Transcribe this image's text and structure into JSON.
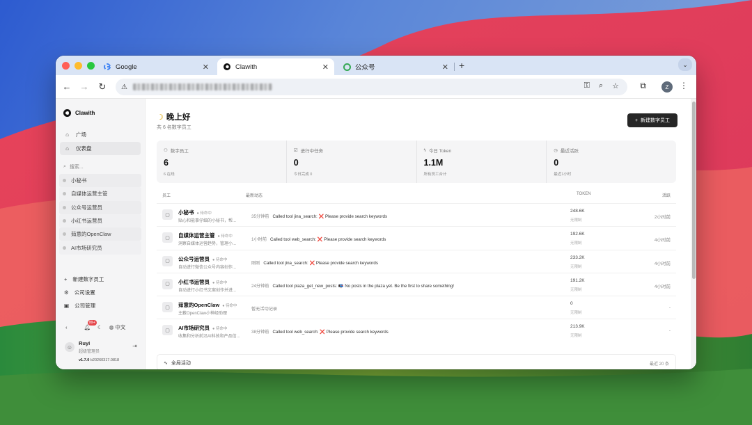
{
  "browser": {
    "tabs": [
      {
        "label": "Google",
        "active": false
      },
      {
        "label": "Clawith",
        "active": true
      },
      {
        "label": "公众号",
        "active": false
      }
    ],
    "new_tab": "+",
    "profile_initial": "Z"
  },
  "app": {
    "brand": "Clawith",
    "nav": [
      {
        "label": "广场",
        "icon": "plaza-icon"
      },
      {
        "label": "仪表盘",
        "icon": "dashboard-icon",
        "active": true
      }
    ],
    "search_placeholder": "搜索...",
    "agents": [
      "小秘书",
      "自媒体运营主管",
      "公众号运营员",
      "小红书运营员",
      "茹意的OpenClaw",
      "AI市场研究员"
    ],
    "actions": [
      {
        "label": "新建数字员工",
        "icon": "plus-icon"
      },
      {
        "label": "公司设置",
        "icon": "gear-icon"
      },
      {
        "label": "公司管理",
        "icon": "building-icon"
      }
    ],
    "notification_count": "99+",
    "language": "中文",
    "user": {
      "name": "Ruyi",
      "role": "超级管理员"
    },
    "version": "v1.7.0",
    "build": "b20260317.0818"
  },
  "dashboard": {
    "greeting": "晚上好",
    "subtitle": "共 6 名数字员工",
    "new_button": "新建数字员工",
    "stats": [
      {
        "label": "数字员工",
        "value": "6",
        "hint": "6 在线"
      },
      {
        "label": "进行中任务",
        "value": "0",
        "hint": "今日完成 0"
      },
      {
        "label": "今日 Token",
        "value": "1.1M",
        "hint": "所有员工合计"
      },
      {
        "label": "最近活跃",
        "value": "0",
        "hint": "最近1小时"
      }
    ],
    "columns": {
      "employee": "员工",
      "activity": "最新动态",
      "token": "TOKEN",
      "active": "活跃"
    },
    "rows": [
      {
        "name": "小秘书",
        "status": "待命中",
        "desc": "贴心和能事仔细的小秘书，帮...",
        "time": "35分钟前",
        "action": "Called tool jina_search:",
        "mark": "❌",
        "message": "Please provide search keywords",
        "token": "248.6K",
        "limit": "无限制",
        "last": "2小时前"
      },
      {
        "name": "自媒体运营主管",
        "status": "待命中",
        "desc": "洞察自媒体运营趋势，管理小...",
        "time": "1小时前",
        "action": "Called tool web_search:",
        "mark": "❌",
        "message": "Please provide search keywords",
        "token": "192.6K",
        "limit": "无限制",
        "last": "4小时前"
      },
      {
        "name": "公众号运营员",
        "status": "待命中",
        "desc": "自动进行微信公众号内容创作...",
        "time": "刚刚",
        "action": "Called tool jina_search:",
        "mark": "❌",
        "message": "Please provide search keywords",
        "token": "233.2K",
        "limit": "无限制",
        "last": "4小时前"
      },
      {
        "name": "小红书运营员",
        "status": "待命中",
        "desc": "自动进行小红书文案创作并进...",
        "time": "24分钟前",
        "action": "Called tool plaza_get_new_posts:",
        "mark": "📭",
        "message": "No posts in the plaza yet. Be the first to share something!",
        "token": "191.2K",
        "limit": "无限制",
        "last": "4小时前"
      },
      {
        "name": "茹意的OpenClaw",
        "status": "待命中",
        "desc": "主薮OpenClaw小神经助理",
        "time": "",
        "action": "暂无活动记录",
        "mark": "",
        "message": "",
        "token": "0",
        "limit": "无限制",
        "last": "-"
      },
      {
        "name": "AI市场研究员",
        "status": "待命中",
        "desc": "收集和分析前沿AI科技和产品信...",
        "time": "38分钟前",
        "action": "Called tool web_search:",
        "mark": "❌",
        "message": "Please provide search keywords",
        "token": "213.9K",
        "limit": "无限制",
        "last": "-"
      }
    ],
    "global_activity": "全局活动",
    "recent_count": "最近 20 条"
  },
  "colors": {
    "accent": "#262626",
    "error": "#e23636",
    "tabbar": "#d9e4f5"
  }
}
